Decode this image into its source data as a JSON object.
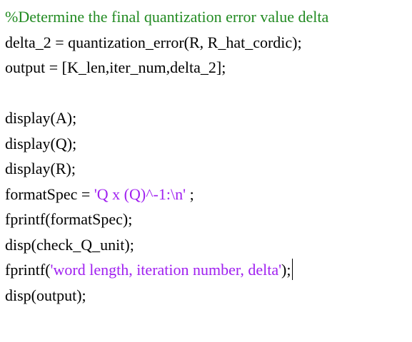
{
  "editor": {
    "lines": [
      {
        "segments": [
          {
            "type": "comment",
            "text": "%Determine the final quantization error value delta"
          }
        ]
      },
      {
        "segments": [
          {
            "type": "code",
            "text": "delta_2 = quantization_error(R, R_hat_cordic);"
          }
        ]
      },
      {
        "segments": [
          {
            "type": "code",
            "text": "output = [K_len,iter_num,delta_2];"
          }
        ]
      },
      {
        "segments": []
      },
      {
        "segments": [
          {
            "type": "code",
            "text": "display(A);"
          }
        ]
      },
      {
        "segments": [
          {
            "type": "code",
            "text": "display(Q);"
          }
        ]
      },
      {
        "segments": [
          {
            "type": "code",
            "text": "display(R);"
          }
        ]
      },
      {
        "segments": [
          {
            "type": "code",
            "text": "formatSpec = "
          },
          {
            "type": "string",
            "text": "'Q x (Q)^-1:\\n'"
          },
          {
            "type": "code",
            "text": " ;"
          }
        ]
      },
      {
        "segments": [
          {
            "type": "code",
            "text": "fprintf(formatSpec);"
          }
        ]
      },
      {
        "segments": [
          {
            "type": "code",
            "text": "disp(check_Q_unit);"
          }
        ]
      },
      {
        "segments": [
          {
            "type": "code",
            "text": "fprintf("
          },
          {
            "type": "string",
            "text": "'word length, iteration number, delta'"
          },
          {
            "type": "code",
            "text": ");"
          }
        ],
        "cursor": true
      },
      {
        "segments": [
          {
            "type": "code",
            "text": "disp(output);"
          }
        ]
      }
    ],
    "colors": {
      "comment": "#228b22",
      "string": "#a020f0",
      "code": "#000000",
      "background": "#ffffff"
    }
  }
}
